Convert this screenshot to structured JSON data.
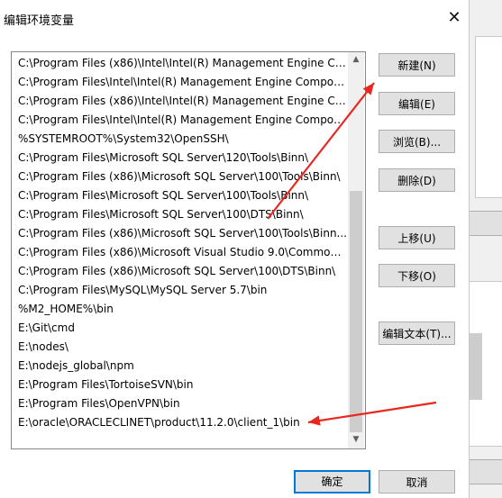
{
  "dialog": {
    "title": "编辑环境变量",
    "close_glyph": "✕"
  },
  "path_list": {
    "items": [
      "C:\\Program Files (x86)\\Intel\\Intel(R) Management Engine Co...",
      "C:\\Program Files\\Intel\\Intel(R) Management Engine Compon...",
      "C:\\Program Files (x86)\\Intel\\Intel(R) Management Engine Co...",
      "C:\\Program Files\\Intel\\Intel(R) Management Engine Compon...",
      "%SYSTEMROOT%\\System32\\OpenSSH\\",
      "C:\\Program Files\\Microsoft SQL Server\\120\\Tools\\Binn\\",
      "C:\\Program Files (x86)\\Microsoft SQL Server\\100\\Tools\\Binn\\",
      "C:\\Program Files\\Microsoft SQL Server\\100\\Tools\\Binn\\",
      "C:\\Program Files\\Microsoft SQL Server\\100\\DTS\\Binn\\",
      "C:\\Program Files (x86)\\Microsoft SQL Server\\100\\Tools\\Binn...",
      "C:\\Program Files (x86)\\Microsoft Visual Studio 9.0\\Common7...",
      "C:\\Program Files (x86)\\Microsoft SQL Server\\100\\DTS\\Binn\\",
      "C:\\Program Files\\MySQL\\MySQL Server 5.7\\bin",
      "%M2_HOME%\\bin",
      "E:\\Git\\cmd",
      "E:\\nodes\\",
      "E:\\nodejs_global\\npm",
      "E:\\Program Files\\TortoiseSVN\\bin",
      "E:\\Program Files\\OpenVPN\\bin",
      "E:\\oracle\\ORACLECLINET\\product\\11.2.0\\client_1\\bin"
    ],
    "scroll_up_glyph": "▲",
    "scroll_down_glyph": "▼"
  },
  "buttons": {
    "new": "新建(N)",
    "edit": "编辑(E)",
    "browse": "浏览(B)...",
    "delete": "删除(D)",
    "move_up": "上移(U)",
    "move_down": "下移(O)",
    "edit_text": "编辑文本(T)...",
    "ok": "确定",
    "cancel": "取消"
  },
  "colors": {
    "annotation_arrow": "#e8281e",
    "primary_border": "#0078d7"
  }
}
